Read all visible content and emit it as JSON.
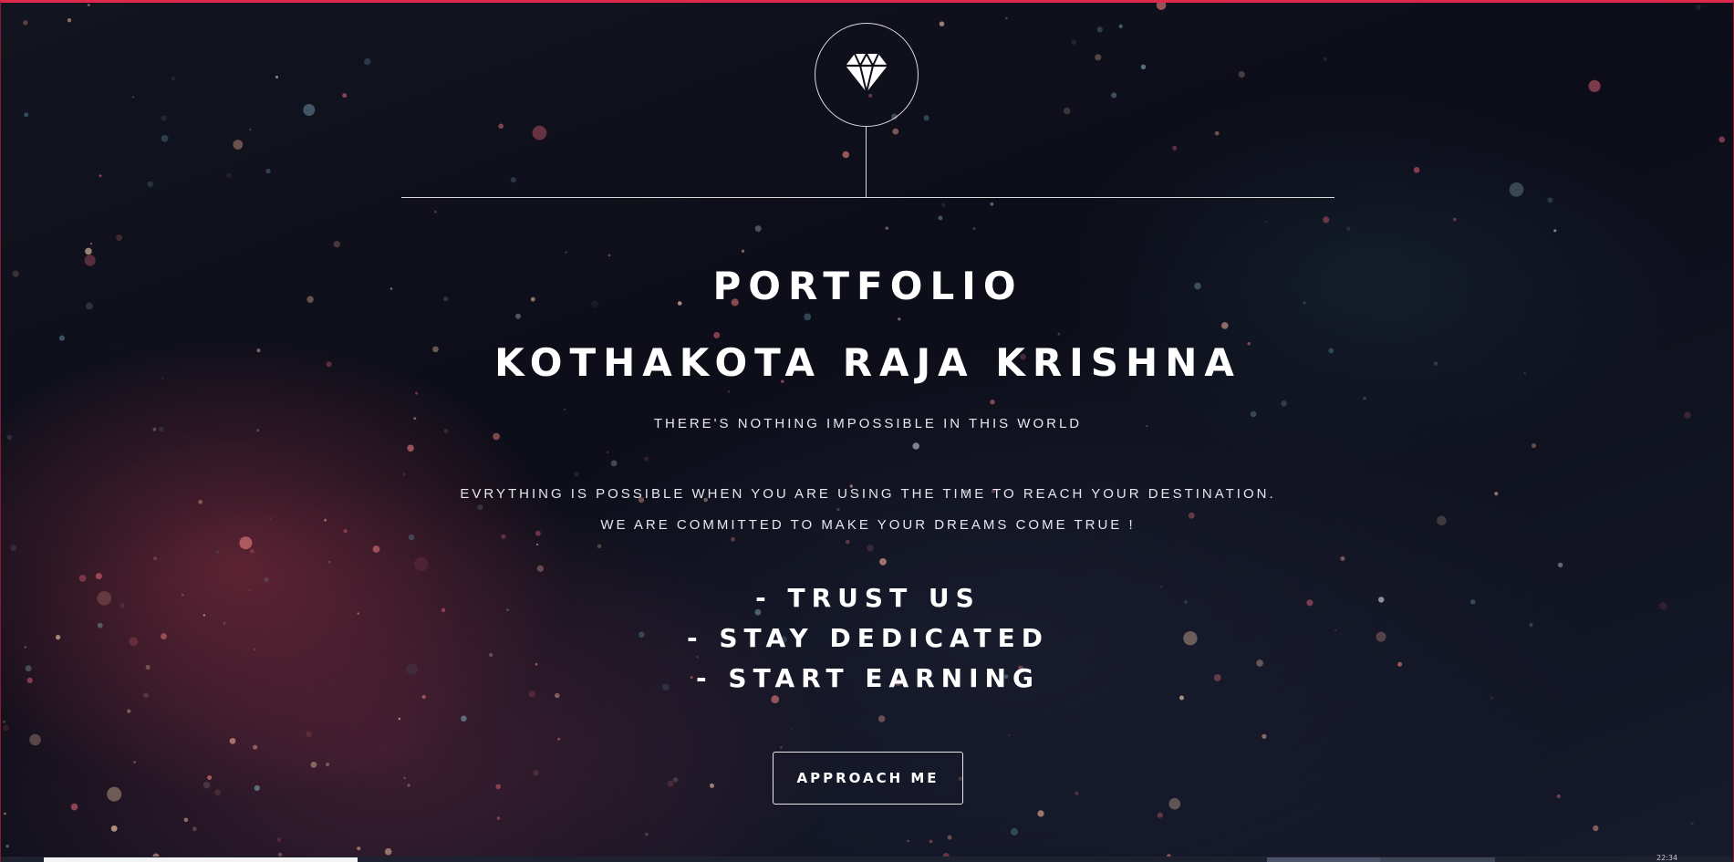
{
  "brand": {
    "icon": "diamond-icon"
  },
  "hero": {
    "title_line1": "PORTFOLIO",
    "title_line2": "KOTHAKOTA RAJA KRISHNA",
    "tagline": "THERE'S NOTHING IMPOSSIBLE IN THIS WORLD",
    "description_line1": "EVRYTHING IS POSSIBLE WHEN YOU ARE USING THE TIME TO REACH YOUR DESTINATION.",
    "description_line2": "WE ARE COMMITTED TO MAKE YOUR DREAMS COME TRUE !",
    "mottos": [
      "- TRUST US",
      "- STAY DEDICATED",
      "- START EARNING"
    ],
    "cta_label": "APPROACH ME"
  },
  "taskbar": {
    "clock": "22:34"
  },
  "colors": {
    "accent_border": "#e0284f",
    "text": "#ffffff",
    "background": "#0b0c18"
  }
}
